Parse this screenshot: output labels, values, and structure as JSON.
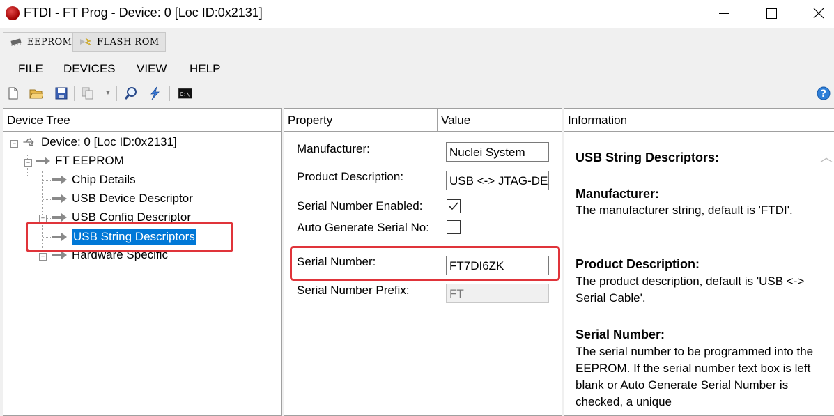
{
  "window": {
    "title": "FTDI - FT Prog - Device: 0 [Loc ID:0x2131]"
  },
  "tabs": [
    {
      "label": "EEPROM"
    },
    {
      "label": "FLASH ROM"
    }
  ],
  "menu": [
    "FILE",
    "DEVICES",
    "VIEW",
    "HELP"
  ],
  "tree": {
    "header": "Device Tree",
    "device": "Device: 0 [Loc ID:0x2131]",
    "eeprom": "FT EEPROM",
    "items": [
      "Chip Details",
      "USB Device Descriptor",
      "USB Config Descriptor",
      "USB String Descriptors",
      "Hardware Specific"
    ],
    "selected": "USB String Descriptors"
  },
  "props": {
    "header_property": "Property",
    "header_value": "Value",
    "manufacturer_label": "Manufacturer:",
    "manufacturer_value": "Nuclei System",
    "product_label": "Product Description:",
    "product_value": "USB <-> JTAG-DE",
    "sn_enabled_label": "Serial Number Enabled:",
    "sn_enabled": true,
    "auto_gen_label": "Auto Generate Serial No:",
    "auto_gen": false,
    "serial_label": "Serial Number:",
    "serial_value": "FT7DI6ZK",
    "prefix_label": "Serial Number Prefix:",
    "prefix_value": "FT"
  },
  "info": {
    "header": "Information",
    "title": "USB String Descriptors:",
    "manufacturer_heading": "Manufacturer:",
    "manufacturer_text": "The manufacturer string, default is 'FTDI'.",
    "product_heading": "Product Description:",
    "product_text": "The product description, default is 'USB <-> Serial Cable'.",
    "serial_heading": "Serial Number:",
    "serial_text": "The serial number to be programmed into the EEPROM. If the serial number text box is left blank or Auto Generate Serial Number is checked, a unique"
  },
  "colors": {
    "highlight": "#0078d7",
    "annotation": "#e0343a"
  }
}
